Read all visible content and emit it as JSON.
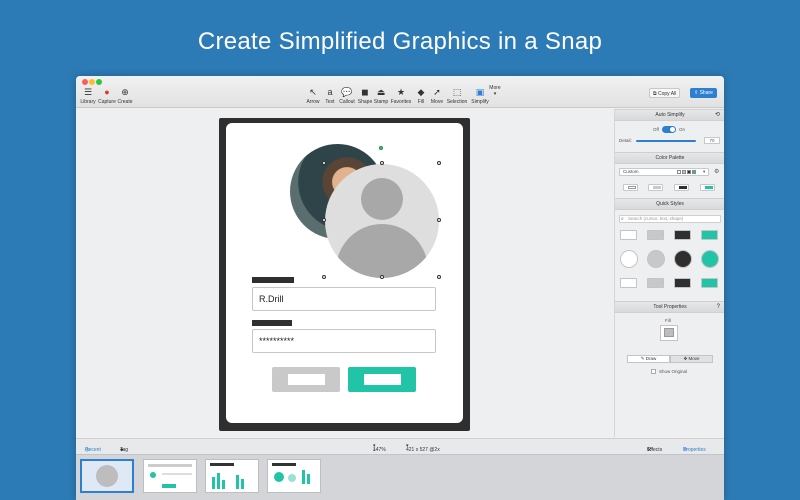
{
  "headline": "Create Simplified Graphics in a Snap",
  "toolbar": {
    "left": [
      {
        "label": "Library",
        "icon": "hamburger-icon"
      },
      {
        "label": "Capture",
        "icon": "record-icon"
      },
      {
        "label": "Create",
        "icon": "plus-circle-icon"
      }
    ],
    "tools": [
      {
        "label": "Arrow",
        "icon": "arrow-icon"
      },
      {
        "label": "Text",
        "icon": "text-icon"
      },
      {
        "label": "Callout",
        "icon": "callout-icon"
      },
      {
        "label": "Shape",
        "icon": "shape-icon"
      },
      {
        "label": "Stamp",
        "icon": "stamp-icon"
      },
      {
        "label": "Favorites",
        "icon": "star-icon"
      },
      {
        "label": "Fill",
        "icon": "fill-icon"
      },
      {
        "label": "Move",
        "icon": "move-icon"
      },
      {
        "label": "Selection",
        "icon": "selection-icon"
      },
      {
        "label": "Simplify",
        "icon": "simplify-icon"
      },
      {
        "label": "More",
        "icon": "chevron-down-icon"
      }
    ],
    "copy_all": "Copy All",
    "share": "Share"
  },
  "mockup": {
    "username": "R.Drill",
    "password": "**********"
  },
  "panel": {
    "auto_simplify": {
      "title": "Auto Simplify",
      "off": "Off",
      "on": "On",
      "detail_label": "Detail:",
      "detail_value": "70",
      "enabled": true
    },
    "color_palette": {
      "title": "Color Palette",
      "selected": "Custom",
      "colors": [
        "#ffffff",
        "#c8c8c8",
        "#2f2f2f",
        "#22c4a7"
      ]
    },
    "quick_styles": {
      "title": "Quick Styles",
      "search_placeholder": "Search (cursor, text, shape)"
    },
    "tool_properties": {
      "title": "Tool Properties",
      "fill_label": "Fill",
      "draw": "Draw",
      "move": "Move",
      "show_original": "Show Original"
    }
  },
  "status": {
    "recent": "Recent",
    "tag": "Tag",
    "zoom": "147%",
    "dimensions": "421 x 527 @2x",
    "effects": "Effects",
    "properties": "Properties"
  },
  "colors": {
    "background": "#2c7bb6",
    "accent": "#2f7fd1",
    "teal": "#22c4a7",
    "dark": "#2f2f2f"
  }
}
